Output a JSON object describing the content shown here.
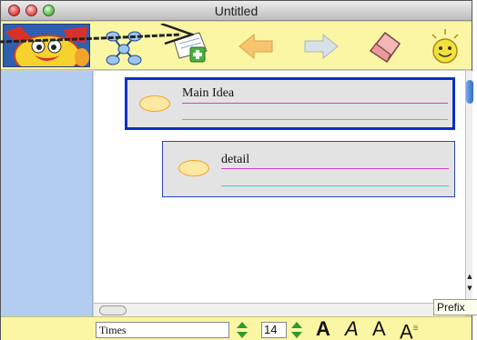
{
  "window": {
    "title": "Untitled"
  },
  "toolbar": {
    "tools": [
      {
        "icon": "avatar-creature-icon"
      },
      {
        "icon": "map-node-icon"
      },
      {
        "icon": "add-note-icon"
      },
      {
        "icon": "back-arrow-icon"
      },
      {
        "icon": "forward-arrow-icon"
      },
      {
        "icon": "eraser-icon"
      },
      {
        "icon": "bright-idea-icon"
      }
    ]
  },
  "canvas": {
    "cards": [
      {
        "text": "Main Idea",
        "selected": true
      },
      {
        "text": "detail",
        "selected": false
      }
    ]
  },
  "tooltip": {
    "text": "Prefix"
  },
  "format": {
    "font_name": "Times",
    "font_size": "14",
    "bold_glyph": "A",
    "italic_glyph": "A",
    "plain_glyph": "A",
    "superscript_glyph": "A"
  },
  "colors": {
    "toolbar_bg": "#fbf6a3",
    "sidebar_bg": "#b3cdf0",
    "selection_border": "#0a2fc4",
    "card_bg": "#e3e3e3",
    "magenta_rule": "#d23cd2",
    "cyan_rule": "#36cfd6"
  }
}
